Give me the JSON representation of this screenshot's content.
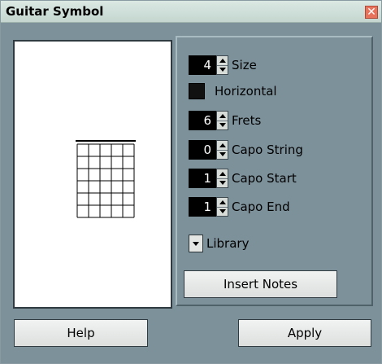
{
  "window": {
    "title": "Guitar Symbol",
    "close_icon": "close-icon"
  },
  "controls": {
    "size": {
      "value": "4",
      "label": "Size"
    },
    "horizontal": {
      "label": "Horizontal",
      "checked": true
    },
    "frets": {
      "value": "6",
      "label": "Frets"
    },
    "capo_string": {
      "value": "0",
      "label": "Capo String"
    },
    "capo_start": {
      "value": "1",
      "label": "Capo Start"
    },
    "capo_end": {
      "value": "1",
      "label": "Capo End"
    },
    "library": {
      "label": "Library"
    }
  },
  "buttons": {
    "insert_notes": "Insert Notes",
    "help": "Help",
    "apply": "Apply"
  },
  "chord_diagram": {
    "strings": 6,
    "frets": 6
  }
}
